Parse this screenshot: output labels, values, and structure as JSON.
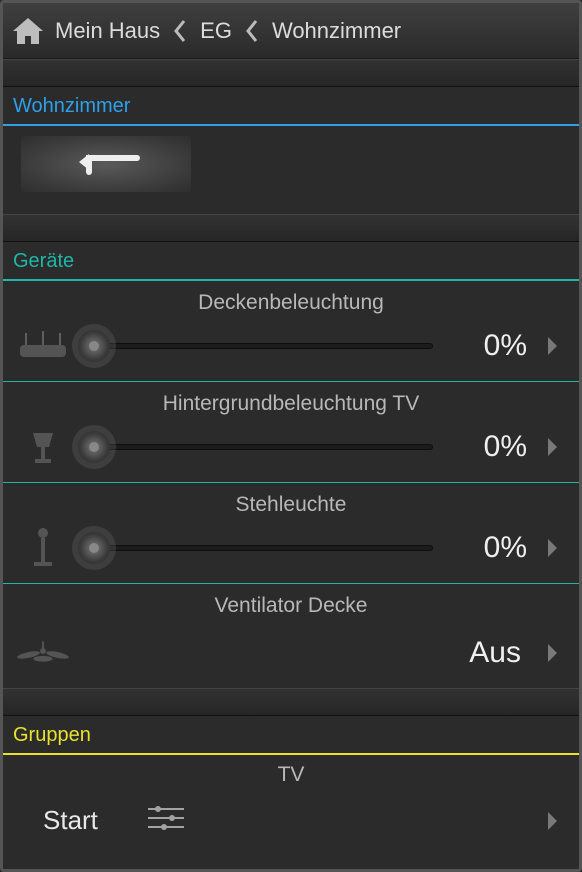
{
  "nav": {
    "home_label": "Mein Haus",
    "crumb1": "EG",
    "crumb2": "Wohnzimmer"
  },
  "room": {
    "title": "Wohnzimmer"
  },
  "devices_section_title": "Geräte",
  "devices": [
    {
      "name": "Deckenbeleuchtung",
      "value": "0%",
      "icon": "ceiling-light"
    },
    {
      "name": "Hintergrundbeleuchtung TV",
      "value": "0%",
      "icon": "lamp-shade"
    },
    {
      "name": "Stehleuchte",
      "value": "0%",
      "icon": "floor-lamp"
    },
    {
      "name": "Ventilator Decke",
      "value": "Aus",
      "icon": "ceiling-fan",
      "no_slider": true
    }
  ],
  "groups_section_title": "Gruppen",
  "groups": [
    {
      "name": "TV",
      "action_label": "Start"
    }
  ]
}
